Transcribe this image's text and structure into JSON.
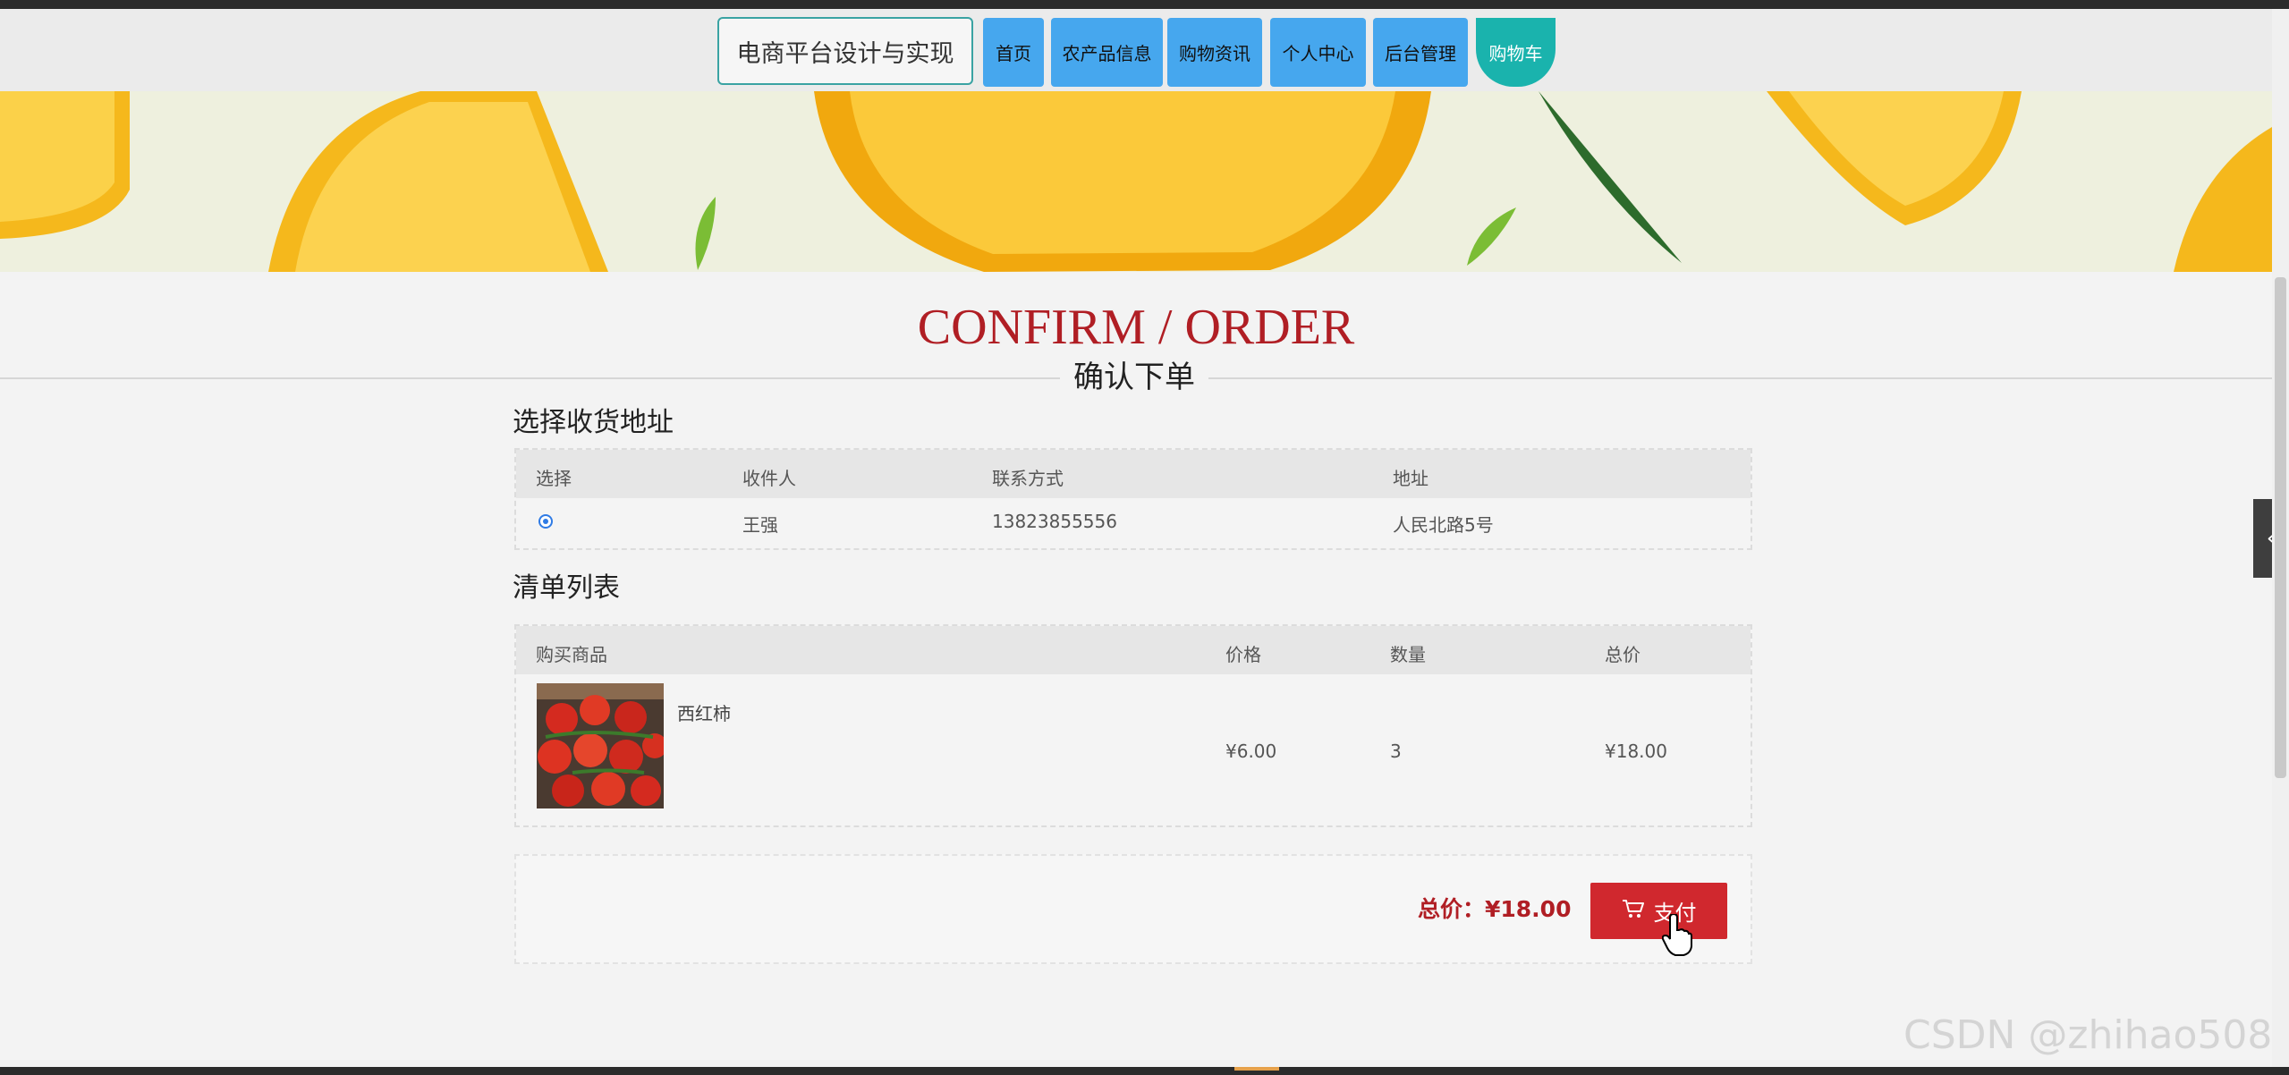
{
  "nav": {
    "brand": "电商平台设计与实现",
    "items": [
      "首页",
      "农产品信息",
      "购物资讯",
      "个人中心",
      "后台管理",
      "购物车"
    ]
  },
  "heading": {
    "en": "CONFIRM / ORDER",
    "zh": "确认下单"
  },
  "address_section": {
    "title": "选择收货地址",
    "columns": [
      "选择",
      "收件人",
      "联系方式",
      "地址"
    ],
    "rows": [
      {
        "selected": true,
        "recipient": "王强",
        "phone": "13823855556",
        "address": "人民北路5号"
      }
    ]
  },
  "list_section": {
    "title": "清单列表",
    "columns": [
      "购买商品",
      "价格",
      "数量",
      "总价"
    ],
    "items": [
      {
        "name": "西红柿",
        "price": "¥6.00",
        "quantity": "3",
        "total": "¥18.00"
      }
    ]
  },
  "summary": {
    "total_label": "总价：¥18.00",
    "pay_label": "支付"
  },
  "side_tab": {
    "glyph": "‹"
  },
  "watermark": "CSDN @zhihao508",
  "colors": {
    "accent_red": "#b01e24",
    "nav_blue": "#46a7ee",
    "nav_active": "#1ab3ad",
    "pay_button": "#d0282e"
  }
}
